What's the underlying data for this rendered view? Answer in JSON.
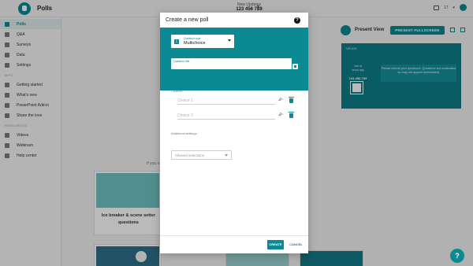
{
  "app": {
    "title": "Polls"
  },
  "event": {
    "name": "New Updates",
    "code": "123 456 789"
  },
  "top_right": {
    "notifications": "17"
  },
  "sidebar": {
    "items": [
      {
        "label": "Polls",
        "icon": "polls-icon",
        "active": true
      },
      {
        "label": "Q&A",
        "icon": "qa-icon"
      },
      {
        "label": "Surveys",
        "icon": "surveys-icon"
      },
      {
        "label": "Data",
        "icon": "data-icon"
      },
      {
        "label": "Settings",
        "icon": "gear-icon"
      }
    ],
    "info_heading": "INFO",
    "info_items": [
      {
        "label": "Getting started",
        "icon": "flag-icon"
      },
      {
        "label": "What's new",
        "icon": "star-icon"
      },
      {
        "label": "PowerPoint Add-in",
        "icon": "powerpoint-icon"
      },
      {
        "label": "Share the love",
        "icon": "heart-icon"
      }
    ],
    "resources_heading": "RESOURCES",
    "resource_items": [
      {
        "label": "Videos",
        "icon": "video-icon"
      },
      {
        "label": "Webinars",
        "icon": "webinar-icon"
      },
      {
        "label": "Help center",
        "icon": "help-center-icon"
      }
    ]
  },
  "present": {
    "label": "Present View",
    "fullscreen_button": "PRESENT FULLSCREEN",
    "preview": {
      "brand": "VEVOX",
      "join_text": "Join at vevox.app",
      "id_label": "ID:",
      "code": "123-456-789",
      "message": "Please submit your questions. Questions are moderated so may not appear immediately"
    }
  },
  "main": {
    "hint_text": "If you n",
    "card1_title": "Ice breaker & scene setter questions"
  },
  "modal": {
    "title": "Create a new poll",
    "question_type_label": "Question type",
    "question_type_value": "Multichoice",
    "question_title_label": "Question title",
    "question_title_value": "",
    "choices_label": "Choices",
    "choices": [
      {
        "placeholder": "Choice 1"
      },
      {
        "placeholder": "Choice 2"
      }
    ],
    "additional_settings_label": "Additional settings",
    "allowed_selections_placeholder": "Allowed selections",
    "create_button": "CREATE",
    "cancel_button": "CANCEL"
  },
  "colors": {
    "brand": "#0c8a93",
    "overlay": "rgba(0,0,0,0.27)"
  },
  "help_fab": "?"
}
